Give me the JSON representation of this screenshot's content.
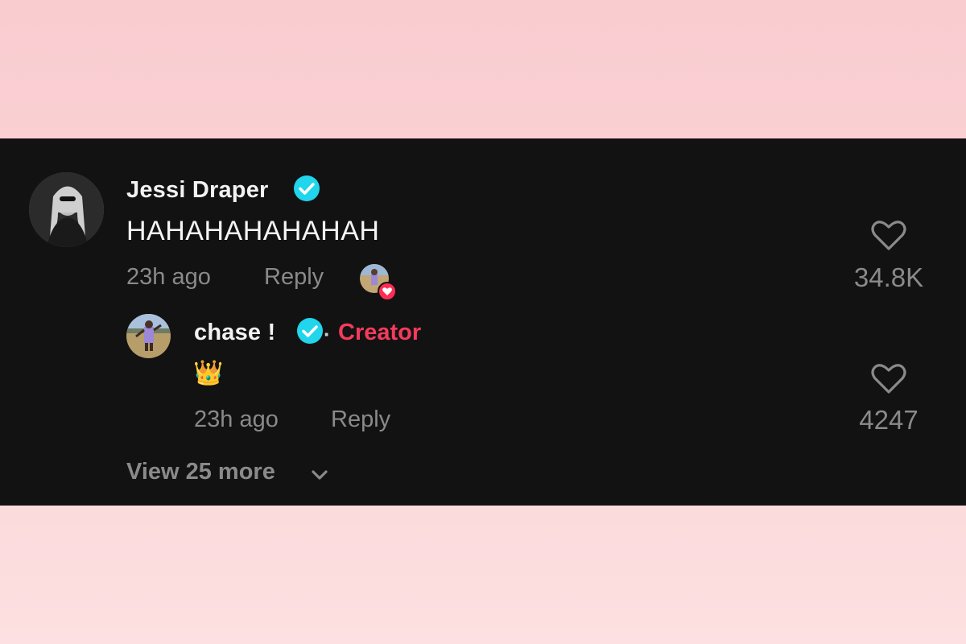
{
  "comment": {
    "username": "Jessi Draper",
    "text": "HAHAHAHAHAHAH",
    "time": "23h ago",
    "reply_label": "Reply",
    "likes": "34.8K",
    "creator_liked": true
  },
  "reply": {
    "username": "chase !",
    "badge": "Creator",
    "separator": "·",
    "emoji": "👑",
    "time": "23h ago",
    "reply_label": "Reply",
    "likes": "4247"
  },
  "view_more": {
    "label": "View 25 more"
  },
  "colors": {
    "background": "#121212",
    "verified": "#20d5ec",
    "creator": "#f43b5c",
    "meta": "#8a8a8a"
  },
  "icons": [
    "verified-badge-icon",
    "heart-icon",
    "chevron-down-icon"
  ]
}
